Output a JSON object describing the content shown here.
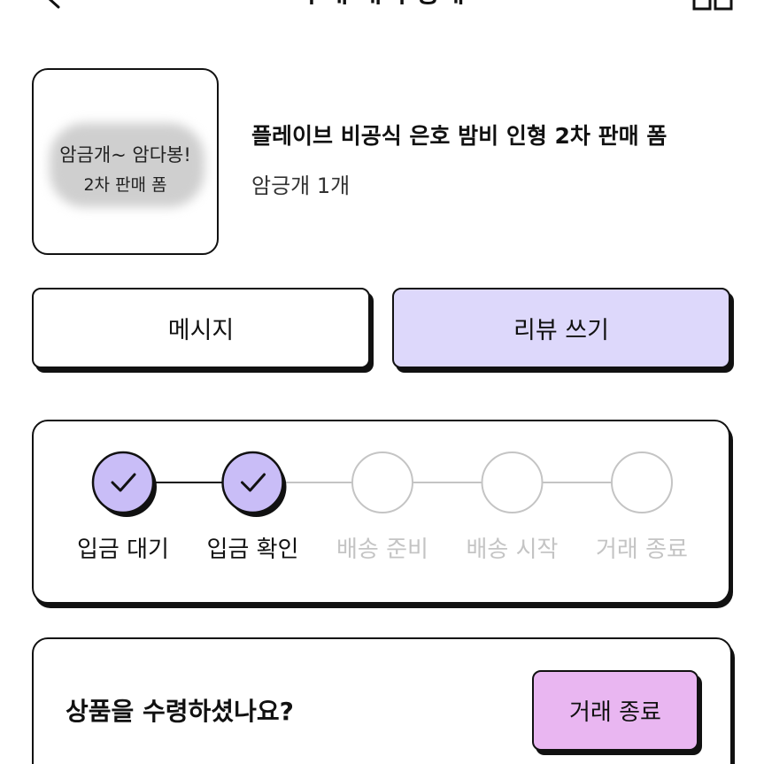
{
  "header": {
    "title": "구매 내역 상세",
    "back_icon": "chevron-left-icon",
    "share_icon": "bag-icon"
  },
  "product": {
    "thumbnail_text_line1": "암금개~ 암다봉!",
    "thumbnail_text_line2": "2차 판매 폼",
    "title": "플레이브 비공식 은호 밤비 인형 2차 판매 폼",
    "option": "암긍개 1개"
  },
  "actions": {
    "message_label": "메시지",
    "review_label": "리뷰 쓰기"
  },
  "progress": {
    "steps": [
      {
        "label": "입금 대기",
        "done": true
      },
      {
        "label": "입금 확인",
        "done": true
      },
      {
        "label": "배송 준비",
        "done": false
      },
      {
        "label": "배송 시작",
        "done": false
      },
      {
        "label": "거래 종료",
        "done": false
      }
    ]
  },
  "receive": {
    "question": "상품을 수령하셨나요?",
    "complete_label": "거래 종료"
  },
  "colors": {
    "review_button": "#ddd8fb",
    "step_done_fill": "#c9bdf7",
    "step_pending_stroke": "#c4c4c4",
    "complete_button": "#e9b6f1"
  }
}
